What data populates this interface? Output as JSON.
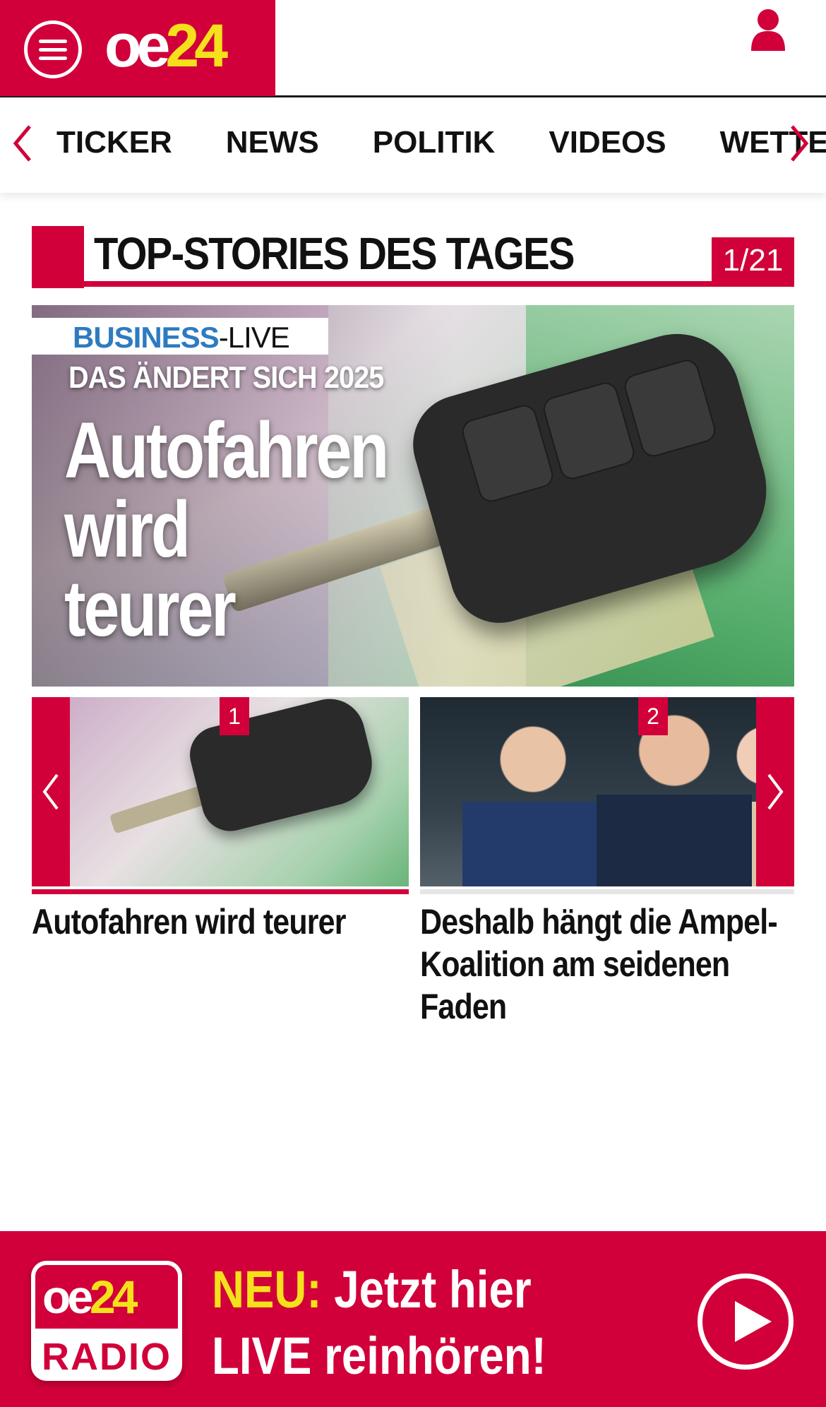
{
  "header": {
    "logo_oe": "oe",
    "logo_num": "24",
    "menu_icon": "hamburger-icon",
    "user_icon": "user-icon",
    "brand_color": "#d1003a",
    "accent_color": "#f5e11b"
  },
  "nav": {
    "items": [
      "TICKER",
      "NEWS",
      "POLITIK",
      "VIDEOS",
      "WETTER"
    ],
    "left_icon": "chevron-left-icon",
    "right_icon": "chevron-right-icon"
  },
  "section": {
    "title": "TOP-STORIES DES TAGES",
    "counter": "1/21"
  },
  "hero": {
    "badge_business": "BUSINESS",
    "badge_live": "-LIVE",
    "subtitle": "DAS ÄNDERT SICH 2025",
    "title_lines": [
      "Autofahren",
      "wird",
      "teurer"
    ]
  },
  "carousel": {
    "cards": [
      {
        "number": "1",
        "title": "Autofahren wird teurer"
      },
      {
        "number": "2",
        "title": "Deshalb hängt die Ampel-Koalition am seidenen Faden"
      }
    ]
  },
  "radio": {
    "logo_oe": "oe",
    "logo_num": "24",
    "logo_label": "RADIO",
    "neu": "NEU:",
    "line1_rest": " Jetzt hier",
    "line2": "LIVE reinhören!",
    "play_icon": "play-icon"
  }
}
